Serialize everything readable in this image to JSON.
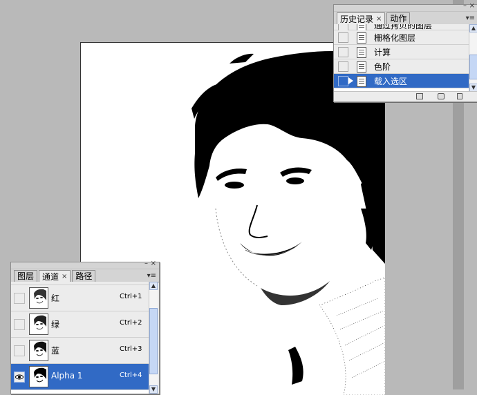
{
  "history_panel": {
    "tabs": [
      {
        "label": "历史记录",
        "active": true
      },
      {
        "label": "动作",
        "active": false
      }
    ],
    "items": [
      {
        "label": "通过拷贝的图层",
        "selected": false
      },
      {
        "label": "栅格化图层",
        "selected": false
      },
      {
        "label": "计算",
        "selected": false
      },
      {
        "label": "色阶",
        "selected": false
      },
      {
        "label": "载入选区",
        "selected": true
      }
    ],
    "footer_icons": [
      "new-document-from-state-icon",
      "create-snapshot-icon",
      "trash-icon"
    ]
  },
  "channels_panel": {
    "tabs": [
      {
        "label": "图层",
        "active": false
      },
      {
        "label": "通道",
        "active": true
      },
      {
        "label": "路径",
        "active": false
      }
    ],
    "channels": [
      {
        "name": "红",
        "shortcut": "Ctrl+1",
        "visible": false,
        "selected": false
      },
      {
        "name": "绿",
        "shortcut": "Ctrl+2",
        "visible": false,
        "selected": false
      },
      {
        "name": "蓝",
        "shortcut": "Ctrl+3",
        "visible": false,
        "selected": false
      },
      {
        "name": "Alpha 1",
        "shortcut": "Ctrl+4",
        "visible": true,
        "selected": true
      }
    ]
  },
  "colors": {
    "selection": "#316ac5",
    "workspace": "#b9b9b9",
    "panel": "#ececec"
  }
}
